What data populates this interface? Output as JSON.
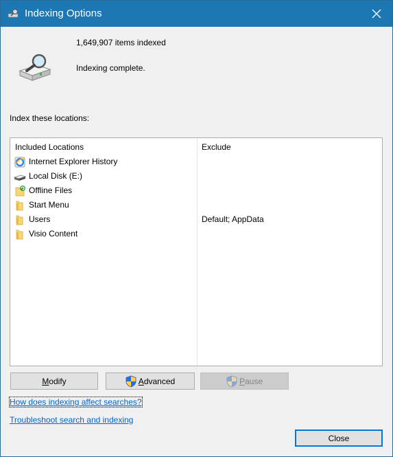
{
  "window": {
    "title": "Indexing Options",
    "titlebar_color": "#1d77b3"
  },
  "summary": {
    "items_indexed": "1,649,907 items indexed",
    "status": "Indexing complete."
  },
  "locations_label": "Index these locations:",
  "table": {
    "columns": [
      "Included Locations",
      "Exclude"
    ],
    "rows": [
      {
        "location": "Internet Explorer History",
        "exclude": "",
        "icon": "ie-history-icon"
      },
      {
        "location": "Local Disk (E:)",
        "exclude": "",
        "icon": "local-disk-icon"
      },
      {
        "location": "Offline Files",
        "exclude": "",
        "icon": "offline-files-folder-icon"
      },
      {
        "location": "Start Menu",
        "exclude": "",
        "icon": "folder-icon"
      },
      {
        "location": "Users",
        "exclude": "Default; AppData",
        "icon": "folder-icon"
      },
      {
        "location": "Visio Content",
        "exclude": "",
        "icon": "folder-icon"
      }
    ]
  },
  "buttons": {
    "modify": {
      "label": "Modify",
      "mnemonic": "M",
      "rest": "odify"
    },
    "advanced": {
      "label": "Advanced",
      "mnemonic": "A",
      "rest": "dvanced"
    },
    "pause": {
      "label": "Pause",
      "mnemonic": "P",
      "rest": "ause",
      "enabled": false
    },
    "close": {
      "label": "Close"
    }
  },
  "links": {
    "how_indexing": "How does indexing affect searches?",
    "troubleshoot": "Troubleshoot search and indexing"
  },
  "colors": {
    "link": "#0066cc",
    "focus_border": "#0078d7"
  }
}
